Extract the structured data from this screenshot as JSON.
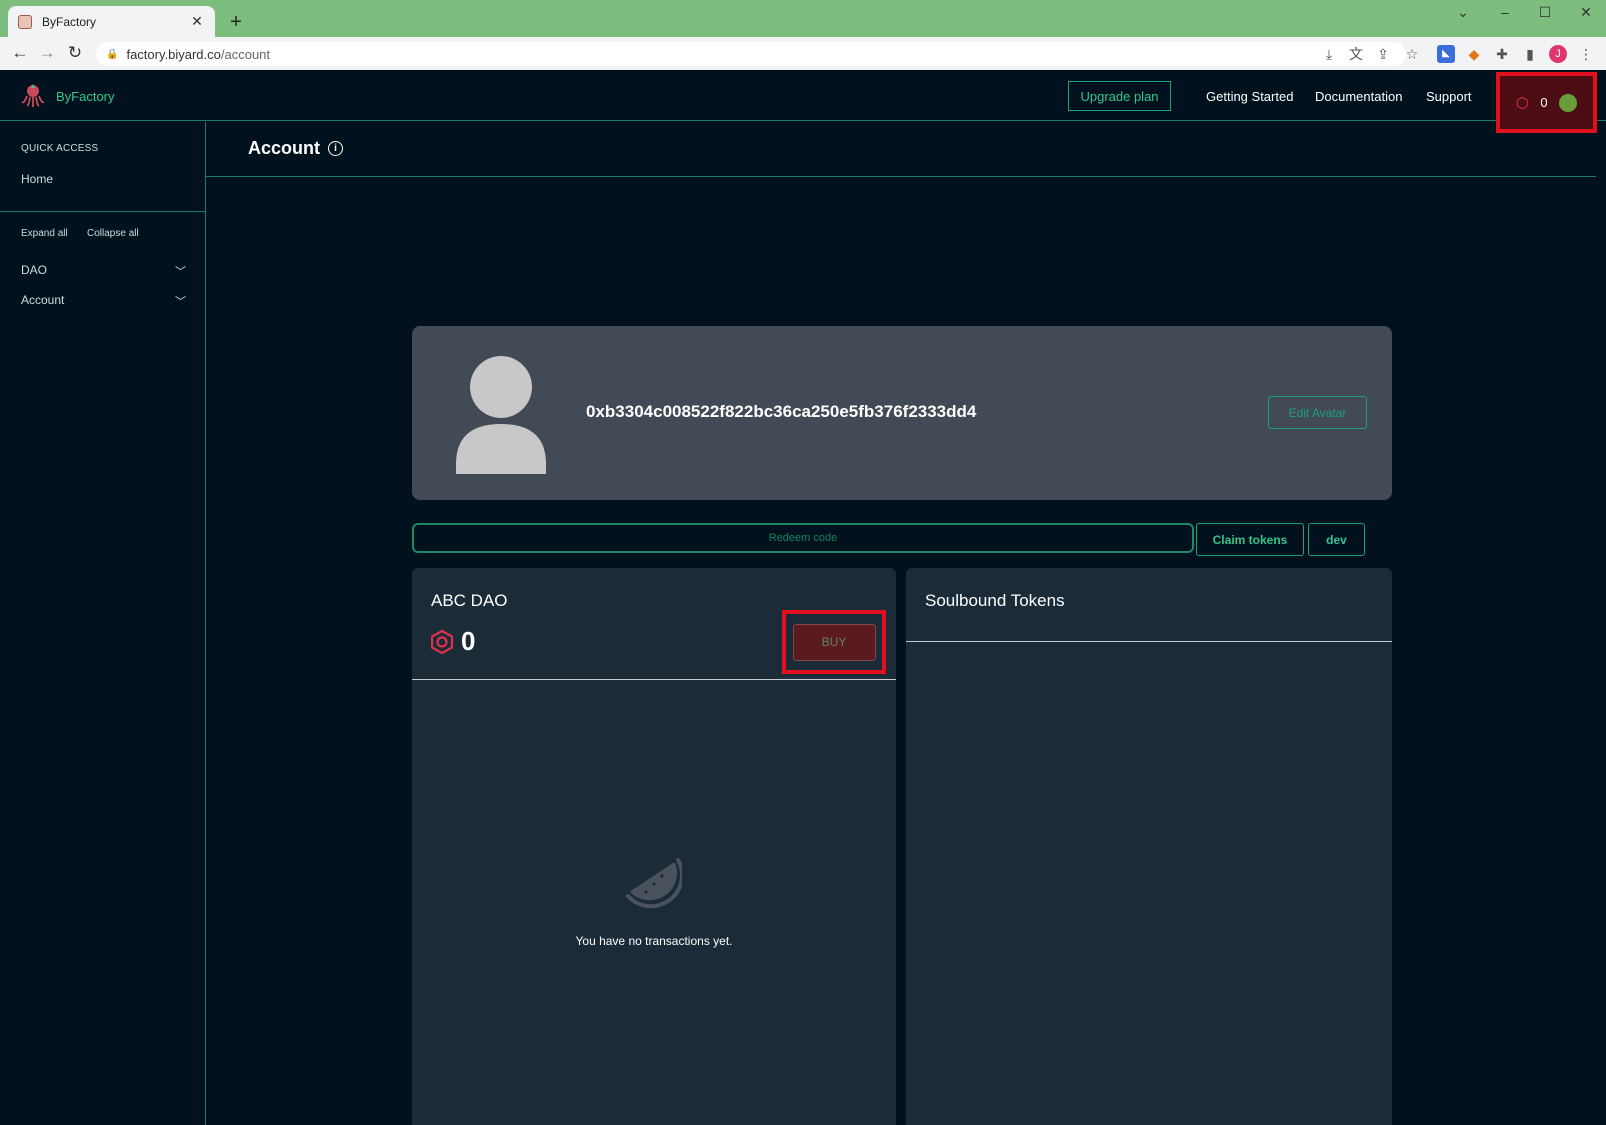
{
  "browser": {
    "tab_title": "ByFactory",
    "tab_close": "✕",
    "new_tab": "+",
    "url_host": "factory.biyard.co",
    "url_path": "/account",
    "profile_initial": "J"
  },
  "header": {
    "brand": "ByFactory",
    "upgrade_label": "Upgrade plan",
    "nav": [
      "Getting Started",
      "Documentation",
      "Support"
    ],
    "credits": "0"
  },
  "sidebar": {
    "quick_access": "QUICK ACCESS",
    "home": "Home",
    "expand_all": "Expand all",
    "collapse_all": "Collapse all",
    "groups": [
      "DAO",
      "Account"
    ]
  },
  "main": {
    "page_title": "Account",
    "wallet_address": "0xb3304c008522f822bc36ca250e5fb376f2333dd4",
    "edit_avatar": "Edit Avatar",
    "redeem_placeholder": "Redeem code",
    "claim_tokens": "Claim tokens",
    "dev": "dev",
    "dao": {
      "name": "ABC DAO",
      "balance": "0",
      "buy": "BUY",
      "empty_text": "You have no transactions yet."
    },
    "sbt_title": "Soulbound Tokens"
  },
  "colors": {
    "accent": "#35c48f",
    "background": "#01121e",
    "panel": "#1b2b38",
    "highlight": "#e0101e"
  }
}
